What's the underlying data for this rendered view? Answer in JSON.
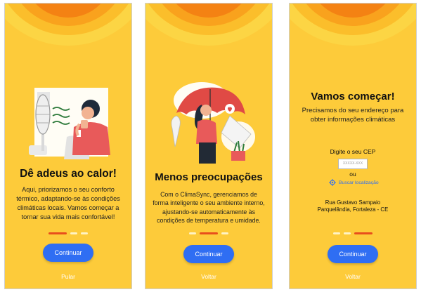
{
  "screens": [
    {
      "title": "Dê adeus ao calor!",
      "description": "Aqui, priorizamos o seu conforto térmico, adaptando-se às condições climáticas locais. Vamos começar a tornar sua vida mais confortável!",
      "continue_label": "Continuar",
      "secondary_label": "Pular",
      "active_dot": 0
    },
    {
      "title": "Menos preocupações",
      "description": "Com o ClimaSync, gerenciamos de forma inteligente o seu ambiente interno, ajustando-se automaticamente às condições de temperatura e umidade.",
      "continue_label": "Continuar",
      "secondary_label": "Voltar",
      "active_dot": 1
    },
    {
      "title": "Vamos começar!",
      "description": "Precisamos do seu endereço para obter informações climáticas",
      "cep_label": "Digite o seu CEP",
      "cep_placeholder": "XXXXX-XXX",
      "or_label": "ou",
      "locate_label": "Buscar localização",
      "address_line1": "Rua Gustavo Sampaio",
      "address_line2": "Parquelândia, Fortaleza - CE",
      "continue_label": "Continuar",
      "secondary_label": "Voltar",
      "active_dot": 2
    }
  ],
  "colors": {
    "background": "#FDCB3A",
    "button": "#2F6EF3",
    "active_dot": "#E84E1C"
  },
  "icons": [
    "fan-woman-illustration",
    "umbrella-woman-illustration",
    "location-target-icon"
  ]
}
